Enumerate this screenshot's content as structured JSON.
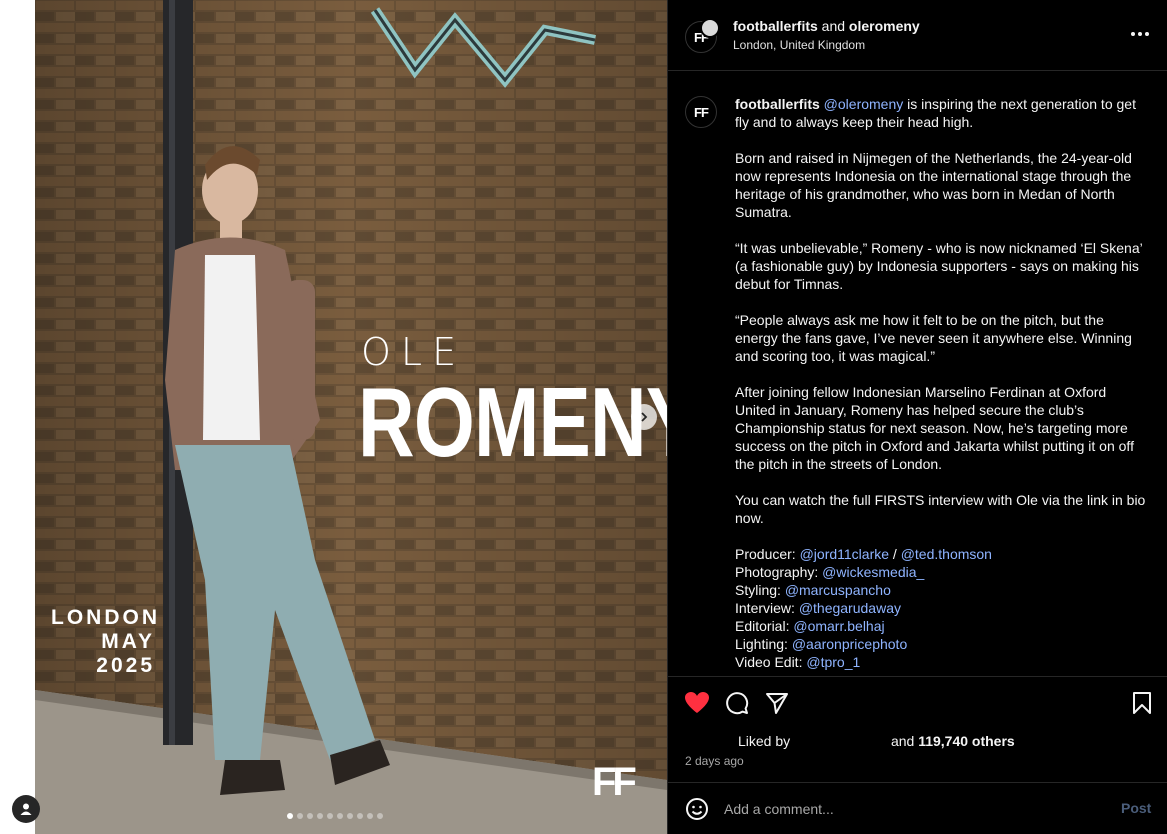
{
  "media": {
    "overlay_first_name": "OLE",
    "overlay_last_name": "ROMENY",
    "overlay_place_line1": "LONDON",
    "overlay_place_line2": "MAY 2025",
    "brand_logo_text": "FF",
    "carousel": {
      "total": 10,
      "active_index": 0
    }
  },
  "header": {
    "avatar_text": "FF",
    "account": "footballerfits",
    "and_word": "and",
    "collaborator": "oleromeny",
    "location": "London, United Kingdom",
    "more_icon": "more-horizontal-icon"
  },
  "caption": {
    "avatar_text": "FF",
    "author": "footballerfits",
    "mention": "@oleromeny",
    "line1_rest": " is inspiring the next generation to get fly and to always keep their head high.",
    "paragraphs": [
      "Born and raised in Nijmegen of the Netherlands, the 24-year-old now represents Indonesia on the international stage through the heritage of his grandmother, who was born in Medan of North Sumatra.",
      "“It was unbelievable,” Romeny - who is now nicknamed ‘El Skena’ (a fashionable guy) by Indonesia supporters - says on making his debut for Timnas.",
      "“People always ask me how it felt to be on the pitch, but the energy the fans gave, I’ve never seen it anywhere else. Winning and scoring too, it was magical.”",
      "After joining fellow Indonesian Marselino Ferdinan at Oxford United in January, Romeny has helped secure the club’s Championship status for next season. Now, he’s targeting more success on the pitch in Oxford and Jakarta whilst putting it on off the pitch in the streets of London.",
      "You can watch the full FIRSTS interview with Ole via the link in bio now."
    ],
    "credits": [
      {
        "role": "Producer: ",
        "handle": "@jord11clarke",
        "sep": " / ",
        "handle2": "@ted.thomson"
      },
      {
        "role": "Photography: ",
        "handle": "@wickesmedia_"
      },
      {
        "role": "Styling: ",
        "handle": "@marcuspancho"
      },
      {
        "role": "Interview: ",
        "handle": "@thegarudaway"
      },
      {
        "role": "Editorial: ",
        "handle": "@omarr.belhaj"
      },
      {
        "role": "Lighting: ",
        "handle": "@aaronpricephoto"
      },
      {
        "role": "Video Edit: ",
        "handle": "@tpro_1"
      }
    ]
  },
  "actions": {
    "liked_by_label": "Liked by",
    "and_label": "and",
    "others": "119,740 others",
    "time": "2 days ago",
    "like_color": "#ff3040"
  },
  "comment": {
    "placeholder": "Add a comment...",
    "post_label": "Post"
  }
}
